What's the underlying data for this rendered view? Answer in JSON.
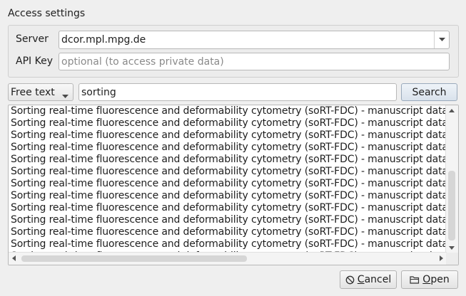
{
  "group": {
    "title": "Access settings",
    "server_label": "Server",
    "server_value": "dcor.mpl.mpg.de",
    "apikey_label": "API Key",
    "apikey_placeholder": "optional (to access private data)"
  },
  "search": {
    "mode": "Free text",
    "query": "sorting",
    "button_label": "Search"
  },
  "results": {
    "items": [
      "Sorting real-time fluorescence and deformability cytometry (soRT-FDC) - manuscript data:",
      "Sorting real-time fluorescence and deformability cytometry (soRT-FDC) - manuscript data:",
      "Sorting real-time fluorescence and deformability cytometry (soRT-FDC) - manuscript data:",
      "Sorting real-time fluorescence and deformability cytometry (soRT-FDC) - manuscript data:",
      "Sorting real-time fluorescence and deformability cytometry (soRT-FDC) - manuscript data:",
      "Sorting real-time fluorescence and deformability cytometry (soRT-FDC) - manuscript data:",
      "Sorting real-time fluorescence and deformability cytometry (soRT-FDC) - manuscript data:",
      "Sorting real-time fluorescence and deformability cytometry (soRT-FDC) - manuscript data:",
      "Sorting real-time fluorescence and deformability cytometry (soRT-FDC) - manuscript data:",
      "Sorting real-time fluorescence and deformability cytometry (soRT-FDC) - manuscript data:",
      "Sorting real-time fluorescence and deformability cytometry (soRT-FDC) - manuscript data:",
      "Sorting real-time fluorescence and deformability cytometry (soRT-FDC) - manuscript data:",
      "Sorting real-time fluorescence and deformability cytometry (soRT-FDC) - manuscript data:"
    ]
  },
  "footer": {
    "cancel_label_first": "C",
    "cancel_label_rest": "ancel",
    "open_label_first": "O",
    "open_label_rest": "pen"
  }
}
